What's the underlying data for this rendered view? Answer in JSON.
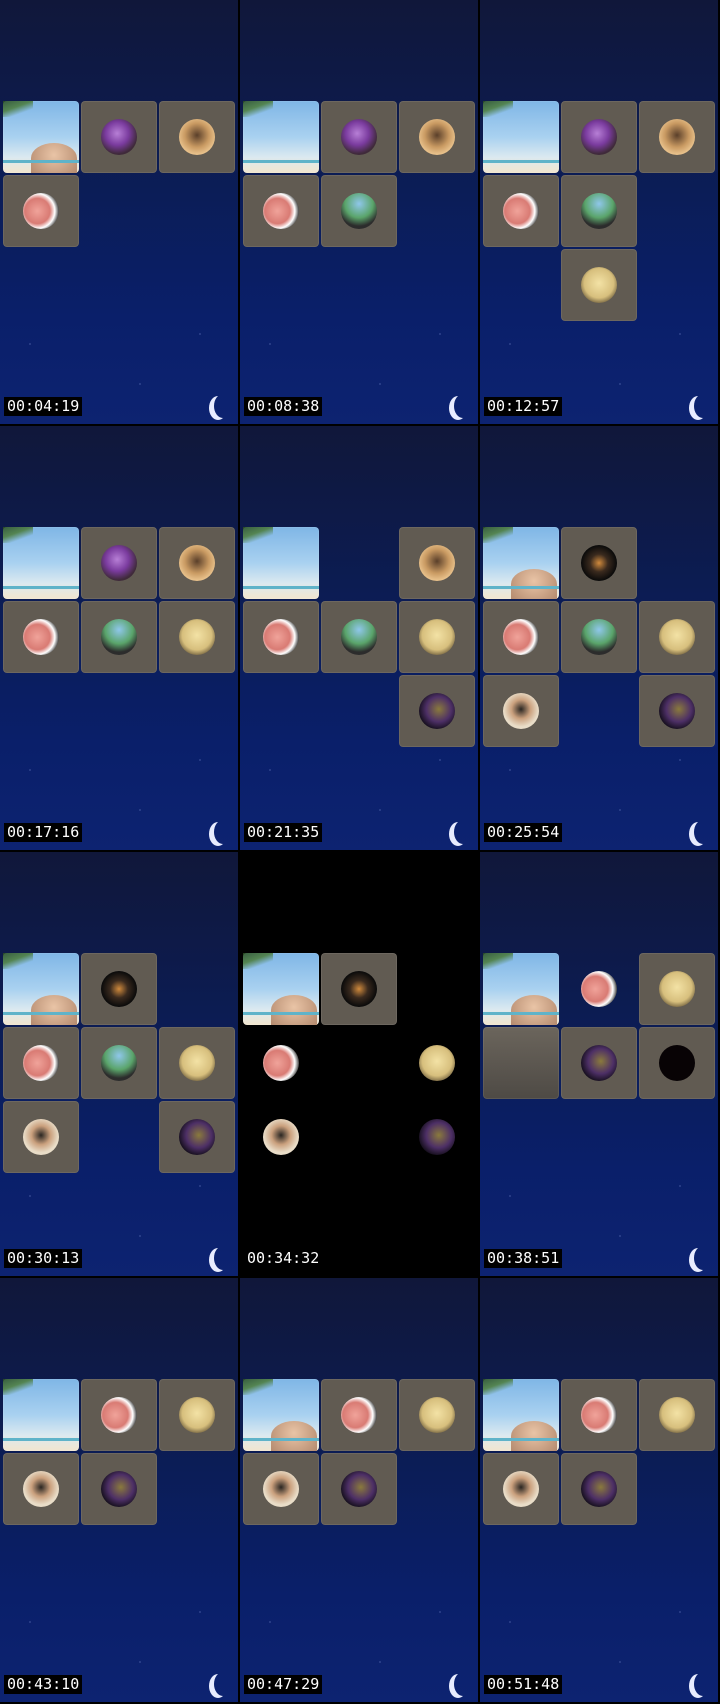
{
  "avatars": {
    "girl-purple": {
      "icon": "avatar-cartoon-purple-hat-icon",
      "bg": "radial-gradient(circle at 45% 40%,#b77fd6 0%,#7a3b9e 40%,#3f2a3a 70%)"
    },
    "long-hair": {
      "icon": "avatar-long-hair-woman-icon",
      "bg": "radial-gradient(circle at 50% 45%,#5a3f2a 0%,#c99a62 45%,#e7c08a 70%)"
    },
    "pink-face": {
      "icon": "avatar-pink-face-icon",
      "bg": "radial-gradient(circle at 40% 50%,#f0a39a 0%,#d97b74 45%,#ffffff 62%,#1b1b1b 80%)"
    },
    "train": {
      "icon": "avatar-train-tracks-icon",
      "bg": "radial-gradient(circle at 50% 30%,#8fc7ea 0%,#5aa46a 45%,#2c2c2c 72%)"
    },
    "pikachu": {
      "icon": "avatar-yellow-creature-icon",
      "bg": "radial-gradient(circle at 50% 45%,#f3e2a5 0%,#d7bf7d 55%,#6a5a3a 80%)"
    },
    "poster": {
      "icon": "avatar-poster-art-icon",
      "bg": "radial-gradient(circle at 55% 45%,#8a7a3c 0%,#4d2f66 45%,#120d18 75%)"
    },
    "dark-figure": {
      "icon": "avatar-dark-figure-icon",
      "bg": "radial-gradient(circle at 50% 50%,#d08a3c 0%,#3a2a1e 35%,#0a0a0a 70%)"
    },
    "sunglasses-man": {
      "icon": "avatar-sunglasses-man-icon",
      "bg": "radial-gradient(circle at 50% 45%,#2a2622 0%,#caa07d 35%,#e9ddc8 65%)"
    },
    "black": {
      "icon": "avatar-black-circle-icon",
      "bg": "#080305"
    }
  },
  "frames": [
    {
      "time": "00:04:19",
      "tiles": [
        {
          "c": 0,
          "r": 0,
          "kind": "beach",
          "face": true
        },
        {
          "c": 1,
          "r": 0,
          "av": "girl-purple"
        },
        {
          "c": 2,
          "r": 0,
          "av": "long-hair"
        },
        {
          "c": 0,
          "r": 1,
          "av": "pink-face"
        }
      ]
    },
    {
      "time": "00:08:38",
      "tiles": [
        {
          "c": 0,
          "r": 0,
          "kind": "beach"
        },
        {
          "c": 1,
          "r": 0,
          "av": "girl-purple"
        },
        {
          "c": 2,
          "r": 0,
          "av": "long-hair"
        },
        {
          "c": 0,
          "r": 1,
          "av": "pink-face"
        },
        {
          "c": 1,
          "r": 1,
          "av": "train"
        }
      ]
    },
    {
      "time": "00:12:57",
      "tiles": [
        {
          "c": 0,
          "r": 0,
          "kind": "beach"
        },
        {
          "c": 1,
          "r": 0,
          "av": "girl-purple"
        },
        {
          "c": 2,
          "r": 0,
          "av": "long-hair"
        },
        {
          "c": 0,
          "r": 1,
          "av": "pink-face"
        },
        {
          "c": 1,
          "r": 1,
          "av": "train"
        },
        {
          "c": 1,
          "r": 2,
          "av": "pikachu"
        }
      ]
    },
    {
      "time": "00:17:16",
      "tiles": [
        {
          "c": 0,
          "r": 0,
          "kind": "beach"
        },
        {
          "c": 1,
          "r": 0,
          "av": "girl-purple"
        },
        {
          "c": 2,
          "r": 0,
          "av": "long-hair"
        },
        {
          "c": 0,
          "r": 1,
          "av": "pink-face"
        },
        {
          "c": 1,
          "r": 1,
          "av": "train"
        },
        {
          "c": 2,
          "r": 1,
          "av": "pikachu"
        }
      ]
    },
    {
      "time": "00:21:35",
      "tiles": [
        {
          "c": 0,
          "r": 0,
          "kind": "beach"
        },
        {
          "c": 2,
          "r": 0,
          "av": "long-hair"
        },
        {
          "c": 0,
          "r": 1,
          "av": "pink-face"
        },
        {
          "c": 1,
          "r": 1,
          "av": "train"
        },
        {
          "c": 2,
          "r": 1,
          "av": "pikachu"
        },
        {
          "c": 2,
          "r": 2,
          "av": "poster"
        }
      ]
    },
    {
      "time": "00:25:54",
      "tiles": [
        {
          "c": 0,
          "r": 0,
          "kind": "beach",
          "face": true
        },
        {
          "c": 1,
          "r": 0,
          "av": "dark-figure"
        },
        {
          "c": 0,
          "r": 1,
          "av": "pink-face"
        },
        {
          "c": 1,
          "r": 1,
          "av": "train"
        },
        {
          "c": 2,
          "r": 1,
          "av": "pikachu"
        },
        {
          "c": 0,
          "r": 2,
          "av": "sunglasses-man"
        },
        {
          "c": 2,
          "r": 2,
          "av": "poster"
        }
      ]
    },
    {
      "time": "00:30:13",
      "tiles": [
        {
          "c": 0,
          "r": 0,
          "kind": "beach",
          "face": true
        },
        {
          "c": 1,
          "r": 0,
          "av": "dark-figure"
        },
        {
          "c": 0,
          "r": 1,
          "av": "pink-face"
        },
        {
          "c": 1,
          "r": 1,
          "av": "train"
        },
        {
          "c": 2,
          "r": 1,
          "av": "pikachu"
        },
        {
          "c": 0,
          "r": 2,
          "av": "sunglasses-man"
        },
        {
          "c": 2,
          "r": 2,
          "av": "poster"
        }
      ]
    },
    {
      "time": "00:34:32",
      "dark": true,
      "tiles": [
        {
          "c": 0,
          "r": 0,
          "kind": "beach",
          "face": true
        },
        {
          "c": 1,
          "r": 0,
          "av": "dark-figure"
        },
        {
          "c": 0,
          "r": 1,
          "av": "pink-face",
          "none": true
        },
        {
          "c": 2,
          "r": 1,
          "av": "pikachu",
          "none": true
        },
        {
          "c": 0,
          "r": 2,
          "av": "sunglasses-man",
          "none": true
        },
        {
          "c": 2,
          "r": 2,
          "av": "poster",
          "none": true
        }
      ]
    },
    {
      "time": "00:38:51",
      "tiles": [
        {
          "c": 0,
          "r": 0,
          "kind": "beach",
          "face": true
        },
        {
          "c": 1,
          "r": 0,
          "av": "pink-face",
          "none": true
        },
        {
          "c": 2,
          "r": 0,
          "av": "pikachu"
        },
        {
          "c": 0,
          "r": 1,
          "kind": "empty"
        },
        {
          "c": 1,
          "r": 1,
          "av": "poster"
        },
        {
          "c": 2,
          "r": 1,
          "av": "black"
        }
      ]
    },
    {
      "time": "00:43:10",
      "tiles": [
        {
          "c": 0,
          "r": 0,
          "kind": "beach"
        },
        {
          "c": 1,
          "r": 0,
          "av": "pink-face"
        },
        {
          "c": 2,
          "r": 0,
          "av": "pikachu"
        },
        {
          "c": 0,
          "r": 1,
          "av": "sunglasses-man"
        },
        {
          "c": 1,
          "r": 1,
          "av": "poster"
        }
      ]
    },
    {
      "time": "00:47:29",
      "tiles": [
        {
          "c": 0,
          "r": 0,
          "kind": "beach",
          "face": true
        },
        {
          "c": 1,
          "r": 0,
          "av": "pink-face"
        },
        {
          "c": 2,
          "r": 0,
          "av": "pikachu"
        },
        {
          "c": 0,
          "r": 1,
          "av": "sunglasses-man"
        },
        {
          "c": 1,
          "r": 1,
          "av": "poster"
        }
      ]
    },
    {
      "time": "00:51:48",
      "tiles": [
        {
          "c": 0,
          "r": 0,
          "kind": "beach",
          "face": true
        },
        {
          "c": 1,
          "r": 0,
          "av": "pink-face"
        },
        {
          "c": 2,
          "r": 0,
          "av": "pikachu"
        },
        {
          "c": 0,
          "r": 1,
          "av": "sunglasses-man"
        },
        {
          "c": 1,
          "r": 1,
          "av": "poster"
        }
      ]
    }
  ]
}
